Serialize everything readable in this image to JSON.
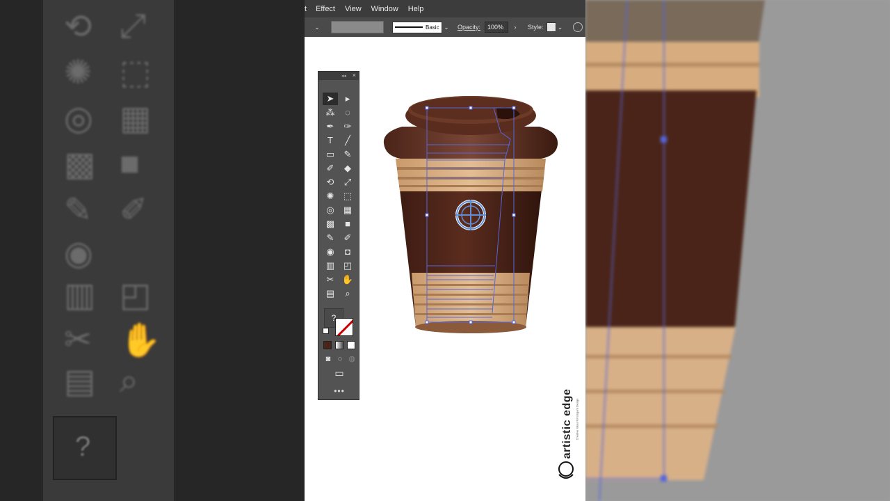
{
  "menubar": {
    "items": [
      {
        "label": "t"
      },
      {
        "label": "Effect"
      },
      {
        "label": "View"
      },
      {
        "label": "Window"
      },
      {
        "label": "Help"
      }
    ]
  },
  "controlbar": {
    "stroke_profile": "Basic",
    "opacity_label": "Opacity:",
    "opacity_value": "100%",
    "style_label": "Style:"
  },
  "toolbar": {
    "fill_unknown_label": "?",
    "more_label": "•••"
  },
  "logo": {
    "text": "artistic edge",
    "tagline": "Creative Ideas for Elegant Design"
  },
  "colors": {
    "cup_brown": "#4a2418",
    "cup_band": "#d2a679",
    "selection": "#5566dd",
    "ui_dark": "#3c3c3c"
  }
}
